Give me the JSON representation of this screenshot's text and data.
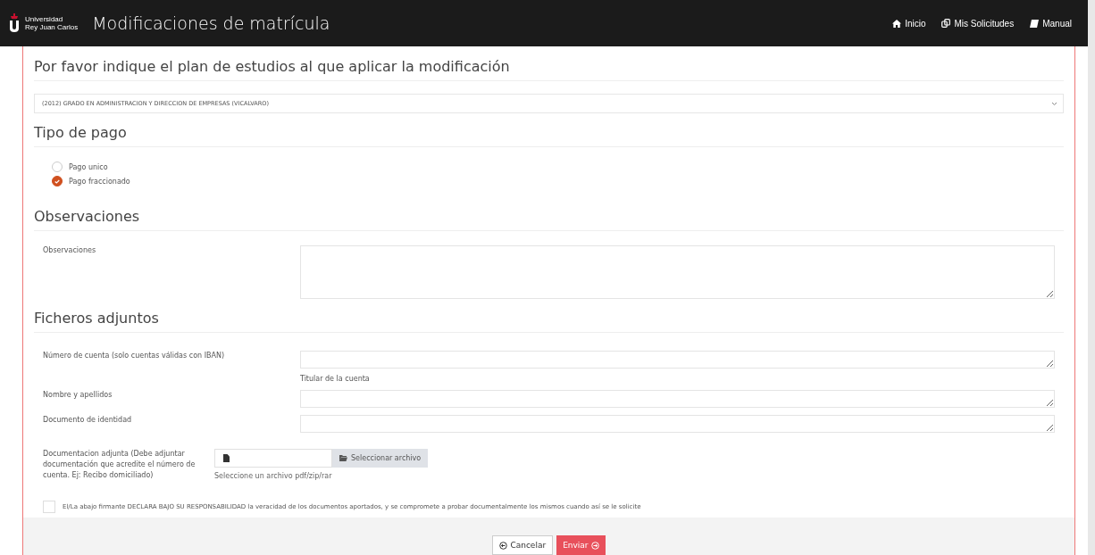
{
  "header": {
    "logo_lines": [
      "Universidad",
      "Rey Juan Carlos"
    ],
    "title": "Modificaciones de matrícula",
    "nav": [
      {
        "label": "Inicio",
        "kind": "home"
      },
      {
        "label": "Mis Solicitudes",
        "kind": "copy"
      },
      {
        "label": "Manual",
        "kind": "book"
      }
    ]
  },
  "plan": {
    "heading": "Por favor indique el plan de estudios al que aplicar la modificación",
    "value": "(2012) GRADO EN ADMINISTRACION Y DIRECCION DE EMPRESAS (VICALVARO)"
  },
  "payment": {
    "heading": "Tipo de pago",
    "options": [
      {
        "label": "Pago unico",
        "selected": false
      },
      {
        "label": "Pago fraccionado",
        "selected": true
      }
    ]
  },
  "observations": {
    "heading": "Observaciones",
    "fields": [
      {
        "label": "Observaciones"
      }
    ]
  },
  "attachments": {
    "heading": "Ficheros adjuntos",
    "fields": [
      {
        "label": "Número de cuenta (solo cuentas válidas con IBAN)",
        "note": "Titular de la cuenta"
      },
      {
        "label": "Nombre y apellidos"
      },
      {
        "label": "Documento de identidad"
      }
    ],
    "file": {
      "label": "Documentacion adjunta (Debe adjuntar documentación que acredite el número de cuenta. Ej: Recibo domiciliado)",
      "button": "Seleccionar archivo",
      "hint": "Seleccione un archivo pdf/zip/rar"
    }
  },
  "declaration": {
    "checked": false,
    "text": "El/La abajo firmante DECLARA BAJO SU RESPONSABILIDAD la veracidad de los documentos aportados, y se compromete a probar documentalmente los mismos cuando así se le solicite"
  },
  "buttons": [
    {
      "label": "Cancelar",
      "kind": "cancel"
    },
    {
      "label": "Enviar",
      "kind": "submit"
    }
  ]
}
